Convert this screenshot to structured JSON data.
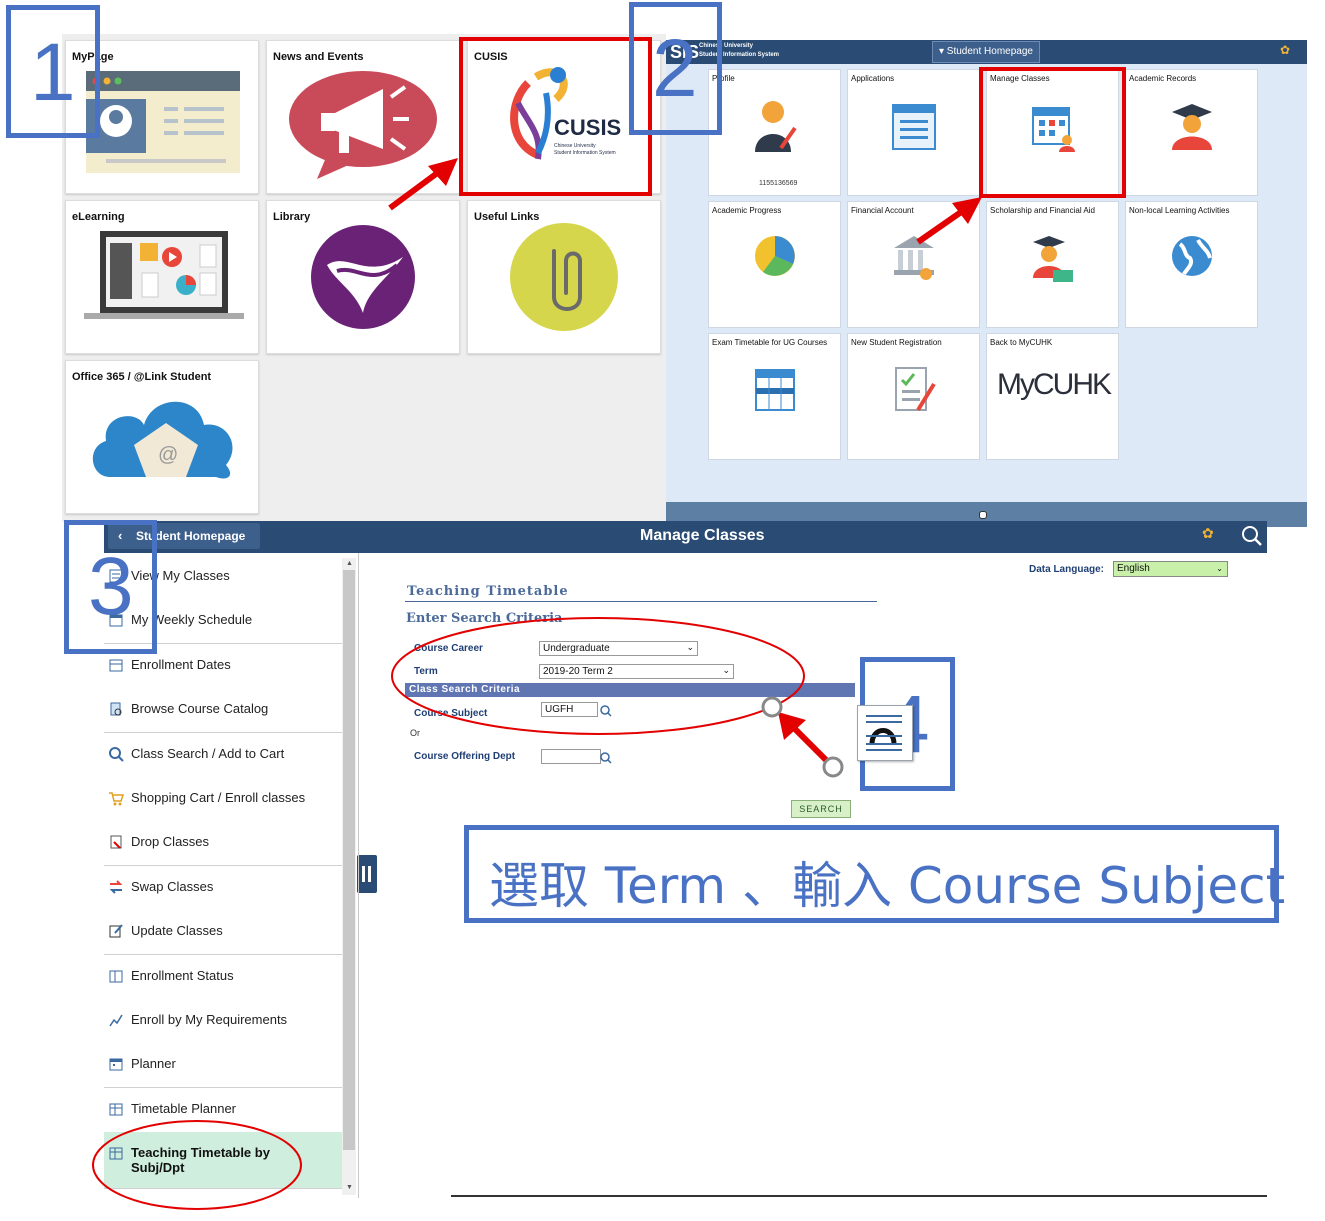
{
  "panel1": {
    "tiles": [
      {
        "title": "MyPage"
      },
      {
        "title": "News and Events"
      },
      {
        "title": "CUSIS"
      },
      {
        "title": "eLearning"
      },
      {
        "title": "Library"
      },
      {
        "title": "Useful Links"
      },
      {
        "title": "Office 365 / @Link Student"
      }
    ],
    "cusis_logo_text": "CUSIS",
    "cusis_logo_sub1": "Chinese University",
    "cusis_logo_sub2": "Student Information System"
  },
  "panel2": {
    "header_brand_line1": "Chinese University",
    "header_brand_line2": "Student Information System",
    "header_brand_short": "SIS",
    "nav_dropdown": "▾ Student Homepage",
    "tiles": [
      {
        "title": "Profile",
        "icon": "profile-icon",
        "extra": "1155136569"
      },
      {
        "title": "Applications",
        "icon": "applications-icon"
      },
      {
        "title": "Manage Classes",
        "icon": "manage-classes-icon"
      },
      {
        "title": "Academic Records",
        "icon": "academic-records-icon"
      },
      {
        "title": "Academic Progress",
        "icon": "pie-chart-icon"
      },
      {
        "title": "Financial Account",
        "icon": "bank-icon"
      },
      {
        "title": "Scholarship and Financial Aid",
        "icon": "scholarship-icon"
      },
      {
        "title": "Non-local Learning Activities",
        "icon": "globe-icon"
      },
      {
        "title": "Exam Timetable for UG Courses",
        "icon": "calendar-icon"
      },
      {
        "title": "New Student Registration",
        "icon": "registration-icon"
      },
      {
        "title": "Back to MyCUHK",
        "icon": "mycuhk-logo",
        "logo_text": "MyCUHK"
      }
    ]
  },
  "panel3": {
    "back_label": "Student Homepage",
    "page_title": "Manage Classes",
    "sidebar": [
      {
        "label": "View My Classes",
        "icon": "class-list-icon"
      },
      {
        "label": "My Weekly Schedule",
        "icon": "schedule-icon"
      },
      {
        "label": "Enrollment Dates",
        "icon": "dates-icon"
      },
      {
        "label": "Browse Course Catalog",
        "icon": "catalog-icon"
      },
      {
        "label": "Class Search / Add to Cart",
        "icon": "search-icon"
      },
      {
        "label": "Shopping Cart / Enroll classes",
        "icon": "cart-icon"
      },
      {
        "label": "Drop Classes",
        "icon": "drop-icon"
      },
      {
        "label": "Swap Classes",
        "icon": "swap-icon"
      },
      {
        "label": "Update Classes",
        "icon": "edit-icon"
      },
      {
        "label": "Enrollment Status",
        "icon": "status-icon"
      },
      {
        "label": "Enroll by My Requirements",
        "icon": "trend-icon"
      },
      {
        "label": "Planner",
        "icon": "planner-icon"
      },
      {
        "label": "Timetable Planner",
        "icon": "timetable-icon"
      },
      {
        "label": "Teaching Timetable by Subj/Dpt",
        "icon": "timetable-icon",
        "selected": true
      }
    ],
    "data_language_label": "Data Language:",
    "data_language_value": "English",
    "section_title": "Teaching Timetable",
    "subtitle": "Enter Search Criteria",
    "course_career_label": "Course Career",
    "course_career_value": "Undergraduate",
    "term_label": "Term",
    "term_value": "2019-20 Term 2",
    "criteria_header": "Class Search Criteria",
    "course_subject_label": "Course Subject",
    "course_subject_value": "UGFH",
    "or_label": "Or",
    "offering_dept_label": "Course Offering Dept",
    "offering_dept_value": "",
    "search_button": "Search"
  },
  "annotations": {
    "step1": "1",
    "step2": "2",
    "step3": "3",
    "step4": "4",
    "caption": "選取 Term 、輸入 Course Subject"
  },
  "colors": {
    "annotation_blue": "#4a72c4",
    "highlight_red": "#e30000",
    "header_navy": "#2a4b73"
  }
}
